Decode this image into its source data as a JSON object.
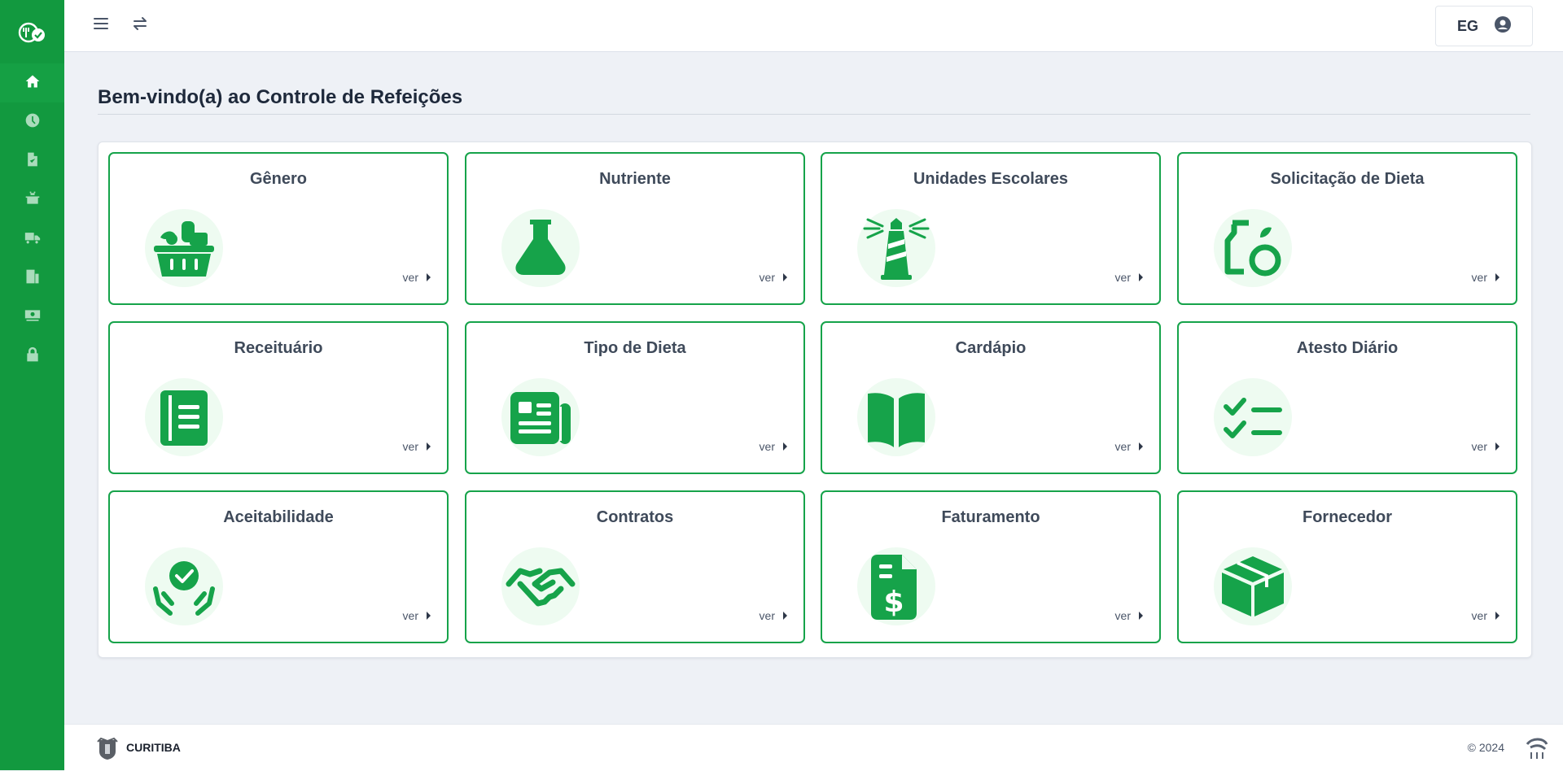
{
  "sidebar": {
    "logo_icon": "meal-shield-logo",
    "items": [
      {
        "icon": "home-icon",
        "active": true
      },
      {
        "icon": "clock-icon",
        "active": false
      },
      {
        "icon": "document-check-icon",
        "active": false
      },
      {
        "icon": "cooking-pot-icon",
        "active": false
      },
      {
        "icon": "truck-icon",
        "active": false
      },
      {
        "icon": "building-icon",
        "active": false
      },
      {
        "icon": "money-icon",
        "active": false
      },
      {
        "icon": "lock-icon",
        "active": false
      }
    ]
  },
  "topbar": {
    "menu_icon": "hamburger-icon",
    "swap_icon": "arrows-swap-icon",
    "user": {
      "initials": "EG",
      "icon": "user-circle-icon"
    }
  },
  "main": {
    "title": "Bem-vindo(a) ao Controle de Refeições",
    "cards": [
      {
        "title": "Gênero",
        "icon": "grocery-basket-icon",
        "link": "ver"
      },
      {
        "title": "Nutriente",
        "icon": "flask-icon",
        "link": "ver"
      },
      {
        "title": "Unidades Escolares",
        "icon": "lighthouse-icon",
        "link": "ver"
      },
      {
        "title": "Solicitação de Dieta",
        "icon": "bottle-apple-icon",
        "link": "ver"
      },
      {
        "title": "Receituário",
        "icon": "notebook-icon",
        "link": "ver"
      },
      {
        "title": "Tipo de Dieta",
        "icon": "newspaper-icon",
        "link": "ver"
      },
      {
        "title": "Cardápio",
        "icon": "open-book-icon",
        "link": "ver"
      },
      {
        "title": "Atesto Diário",
        "icon": "checklist-icon",
        "link": "ver"
      },
      {
        "title": "Aceitabilidade",
        "icon": "hands-check-icon",
        "link": "ver"
      },
      {
        "title": "Contratos",
        "icon": "handshake-icon",
        "link": "ver"
      },
      {
        "title": "Faturamento",
        "icon": "invoice-dollar-icon",
        "link": "ver"
      },
      {
        "title": "Fornecedor",
        "icon": "box-icon",
        "link": "ver"
      }
    ]
  },
  "footer": {
    "brand": "CURITIBA",
    "brand_icon": "city-crest-icon",
    "copyright": "© 2024",
    "partner_icon": "ici-logo-icon"
  },
  "colors": {
    "primary_green": "#12993f",
    "card_border": "#16a34a",
    "icon_green": "#16a34a",
    "icon_bg": "#eefbf1",
    "page_bg": "#eef1f6"
  }
}
